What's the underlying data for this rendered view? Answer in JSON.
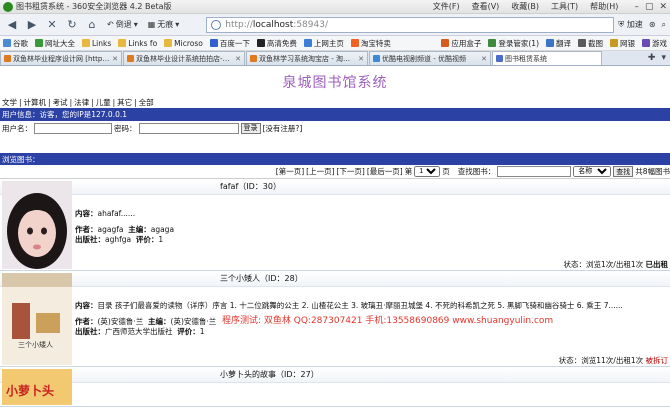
{
  "browser": {
    "title": "图书租赁系统 - 360安全浏览器 4.2 Beta版",
    "menus": [
      "文件(F)",
      "查看(V)",
      "收藏(B)",
      "工具(T)",
      "帮助(H)"
    ],
    "nav": {
      "rewind_label": "倒退",
      "home_label": "无痕"
    },
    "address": {
      "prefix": "http://",
      "host": "localhost",
      "rest": ":58943/"
    },
    "accelerate_label": "加速",
    "bookmarks": [
      "谷歌",
      "网址大全",
      "Links",
      "Links fo",
      "Microso",
      "百度一下",
      "高清免费",
      "上网主页",
      "淘宝特卖"
    ],
    "bookmarks_right": [
      "应用盒子",
      "登录管家(1)",
      "翻译",
      "截图",
      "网银",
      "游戏"
    ],
    "tabs": [
      {
        "label": "双鱼林毕业程序设计网 [http://...",
        "active": false
      },
      {
        "label": "双鱼林毕业设计系统拍拍店-计...",
        "active": false
      },
      {
        "label": "双鱼林学习系统淘宝店 - 淘宝网",
        "active": false
      },
      {
        "label": "优酷电视剧频道 - 优酷视频",
        "active": false
      },
      {
        "label": "图书租赁系统",
        "active": true
      }
    ]
  },
  "site": {
    "title": "泉城图书馆系统",
    "categories": [
      "文学",
      "计算机",
      "考试",
      "法律",
      "儿童",
      "其它",
      "全部"
    ],
    "user_info": "用户信息：访客，您的IP是127.0.0.1",
    "login": {
      "username_label": "用户名：",
      "password_label": "密码：",
      "login_button": "登录",
      "register_link": "[没有注册?]"
    },
    "browse_label": "浏览图书：",
    "pager": {
      "first": "[第一页]",
      "prev": "[上一页]",
      "next": "[下一页]",
      "last": "[最后一页]",
      "page_prefix": "第",
      "page_value": "1",
      "page_suffix": "页",
      "search_label": "查找图书：",
      "search_field": "名称",
      "search_button": "查找",
      "total": "共8幅图书"
    },
    "promo": "程序测试: 双鱼林 QQ:287307421 手机:13558690869 www.shuangyulin.com",
    "books": [
      {
        "title": "fafaf（ID：30）",
        "content_label": "内容：",
        "content": "ahafaf......",
        "author_label": "作者：",
        "author": "agagfa",
        "editor_label": "主编：",
        "editor": "agaga",
        "publisher_label": "出版社：",
        "publisher": "aghfga",
        "rating_label": "评价：",
        "rating": "1",
        "status": "状态：浏览1次/出租1次",
        "status_tag": "已出租"
      },
      {
        "title": "三个小矮人（ID：28）",
        "content_label": "内容：",
        "content": "目录 孩子们最喜爱的读物（详序）序言 1. 十二位跳舞的公主 2. 山楂花公主 3. 玻璃丑·摩丽丑城堡 4. 不死的科希凯之死 5. 黑脚飞骑和幽谷骑士 6. 乘王 7......",
        "author_label": "作者：",
        "author": "(英)安德鲁·兰",
        "editor_label": "主编：",
        "editor": "(英)安德鲁·兰",
        "publisher_label": "出版社：",
        "publisher": "广西师范大学出版社",
        "rating_label": "评价：",
        "rating": "1",
        "status": "状态：浏览11次/出租1次",
        "status_tag": "被拆订"
      },
      {
        "title": "小萝卜头的故事（ID：27）"
      }
    ]
  },
  "colors": {
    "header_bar": "#2b42a4",
    "site_title": "#9e5fbf",
    "promo": "#e4342c"
  }
}
